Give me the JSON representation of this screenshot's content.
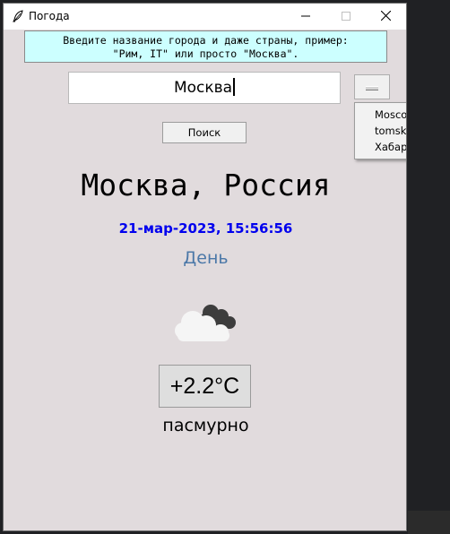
{
  "window": {
    "title": "Погода"
  },
  "hint": {
    "line1": "Введите название города и даже страны, пример:",
    "line2": "\"Рим, IT\" или просто \"Москва\"."
  },
  "search": {
    "value": "Москва",
    "button_label": "Поиск"
  },
  "history_dropdown": {
    "options": [
      "Moscow",
      "tomsk",
      "Хабаровск"
    ]
  },
  "result": {
    "city": "Москва, Россия",
    "datetime": "21-мар-2023, 15:56:56",
    "day_part": "День",
    "weather_icon": "cloudy-icon",
    "temperature": "+2.2°C",
    "condition": "пасмурно"
  },
  "colors": {
    "window_bg": "#e1dbdd",
    "hint_bg": "#ccffff",
    "datetime": "#0000ee",
    "day_part": "#4b78a8"
  }
}
